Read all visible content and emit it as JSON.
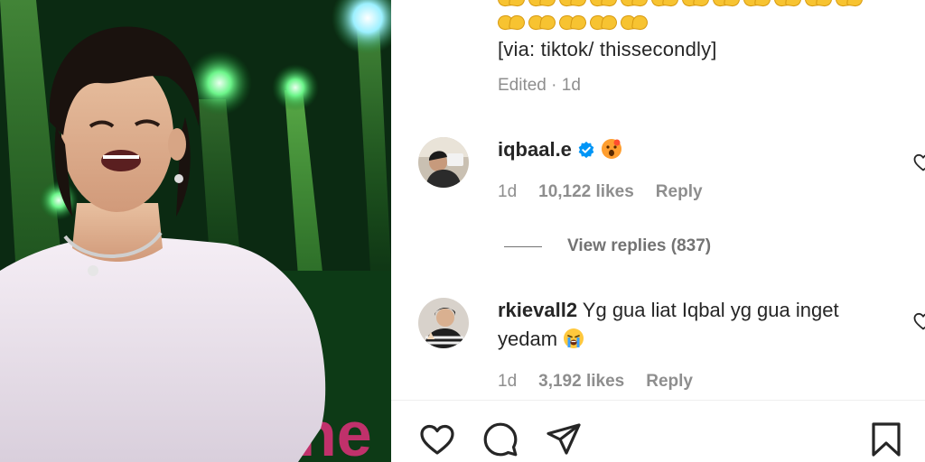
{
  "post": {
    "caption_source": "[via: tiktok/ thissecondly]",
    "edited_label": "Edited · 1d",
    "caption_emojis": [
      "heart-hands",
      "heart-hands",
      "heart-hands",
      "heart-hands",
      "heart-hands"
    ]
  },
  "comments": [
    {
      "username": "iqbaal.e",
      "verified": true,
      "text": "",
      "emoji": "face-with-open-mouth",
      "time": "1d",
      "likes": "10,122 likes",
      "reply_label": "Reply"
    },
    {
      "username": "rkievall2",
      "verified": false,
      "text": "Yg gua liat Iqbal yg gua inget yedam",
      "emoji": "loudly-crying-face",
      "time": "1d",
      "likes": "3,192 likes",
      "reply_label": "Reply"
    }
  ],
  "view_replies": "View replies (837)",
  "colors": {
    "verified_blue": "#0095f6",
    "muted_text": "#8e8e8e",
    "primary_text": "#262626",
    "stage_green": "#22e34a"
  },
  "icons": {
    "like": "heart-outline-icon",
    "comment": "comment-bubble-icon",
    "share": "paper-plane-icon",
    "save": "bookmark-icon"
  }
}
